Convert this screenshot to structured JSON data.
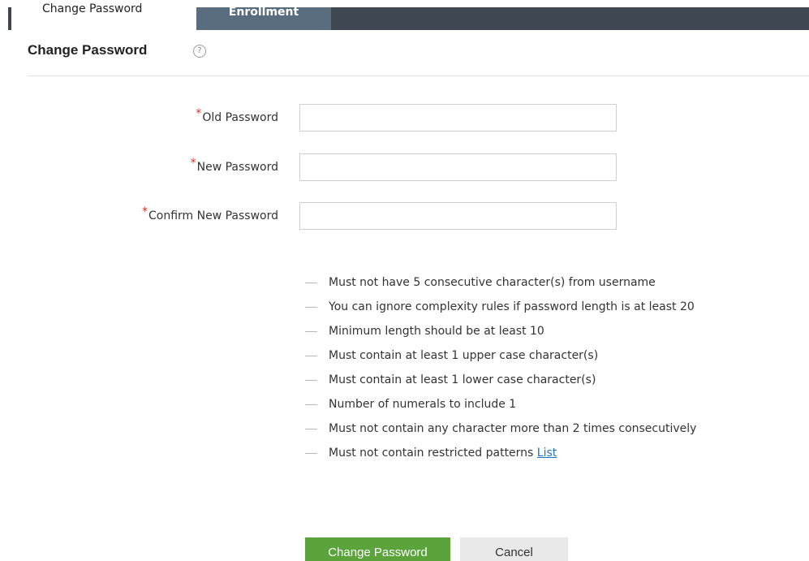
{
  "tabs": {
    "active_label": "Change Password",
    "inactive_label": "Enrollment"
  },
  "header": {
    "title": "Change Password",
    "help_glyph": "?"
  },
  "form": {
    "required_mark": "*",
    "old_password": {
      "label": "Old Password",
      "value": ""
    },
    "new_password": {
      "label": "New Password",
      "value": ""
    },
    "confirm_password": {
      "label": "Confirm New Password",
      "value": ""
    }
  },
  "rules": {
    "items": [
      "Must not have 5 consecutive character(s) from username",
      "You can ignore complexity rules if password length is at least 20",
      "Minimum length should be at least 10",
      "Must contain at least 1 upper case character(s)",
      "Must contain at least 1 lower case character(s)",
      "Number of numerals to include 1",
      "Must not contain any character more than 2 times consecutively",
      "Must not contain restricted patterns"
    ],
    "list_link": "List"
  },
  "buttons": {
    "submit": "Change Password",
    "cancel": "Cancel"
  },
  "colors": {
    "primary_button": "#5aa43b",
    "tab_bar": "#3f4852",
    "tab_inactive": "#596d7e",
    "required": "#d9322c",
    "link": "#1a73c9"
  },
  "icons": {
    "help": "question-circle-icon"
  }
}
